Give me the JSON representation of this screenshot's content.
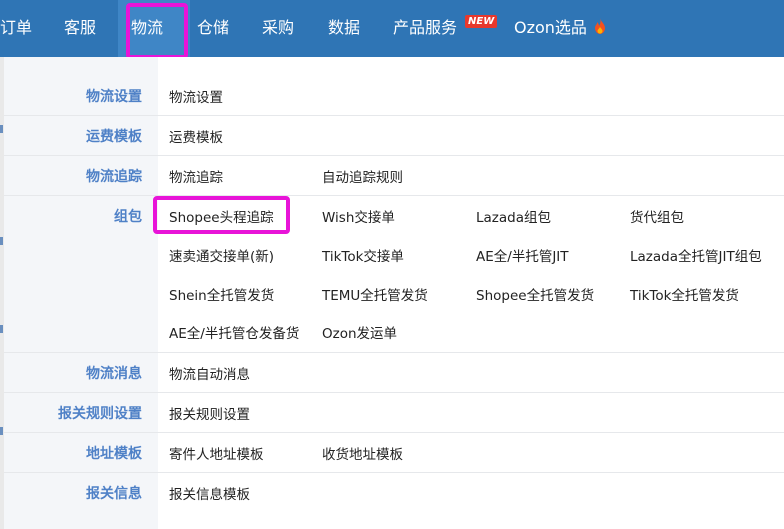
{
  "nav": {
    "items": [
      "订单",
      "客服",
      "物流",
      "仓储",
      "采购",
      "数据",
      "产品服务",
      "Ozon选品"
    ],
    "new_badge": "NEW",
    "active": "物流",
    "fire_icon": "fire-icon"
  },
  "menu": {
    "sections": [
      {
        "label": "物流设置",
        "links": [
          "物流设置"
        ]
      },
      {
        "label": "运费模板",
        "links": [
          "运费模板"
        ]
      },
      {
        "label": "物流追踪",
        "links": [
          "物流追踪",
          "自动追踪规则"
        ]
      },
      {
        "label": "组包",
        "links": [
          "Shopee头程追踪",
          "Wish交接单",
          "Lazada组包",
          "货代组包",
          "速卖通交接单(新)",
          "TikTok交接单",
          "AE全/半托管JIT",
          "Lazada全托管JIT组包",
          "Shein全托管发货",
          "TEMU全托管发货",
          "Shopee全托管发货",
          "TikTok全托管发货",
          "AE全/半托管仓发备货",
          "Ozon发运单"
        ]
      },
      {
        "label": "物流消息",
        "links": [
          "物流自动消息"
        ]
      },
      {
        "label": "报关规则设置",
        "links": [
          "报关规则设置"
        ]
      },
      {
        "label": "地址模板",
        "links": [
          "寄件人地址模板",
          "收货地址模板"
        ]
      },
      {
        "label": "报关信息",
        "links": [
          "报关信息模板"
        ]
      }
    ]
  },
  "colors": {
    "nav_bg": "#2f75b5",
    "label_blue": "#4f81c7",
    "highlight": "#e814d8",
    "new_badge": "#e8382c"
  }
}
